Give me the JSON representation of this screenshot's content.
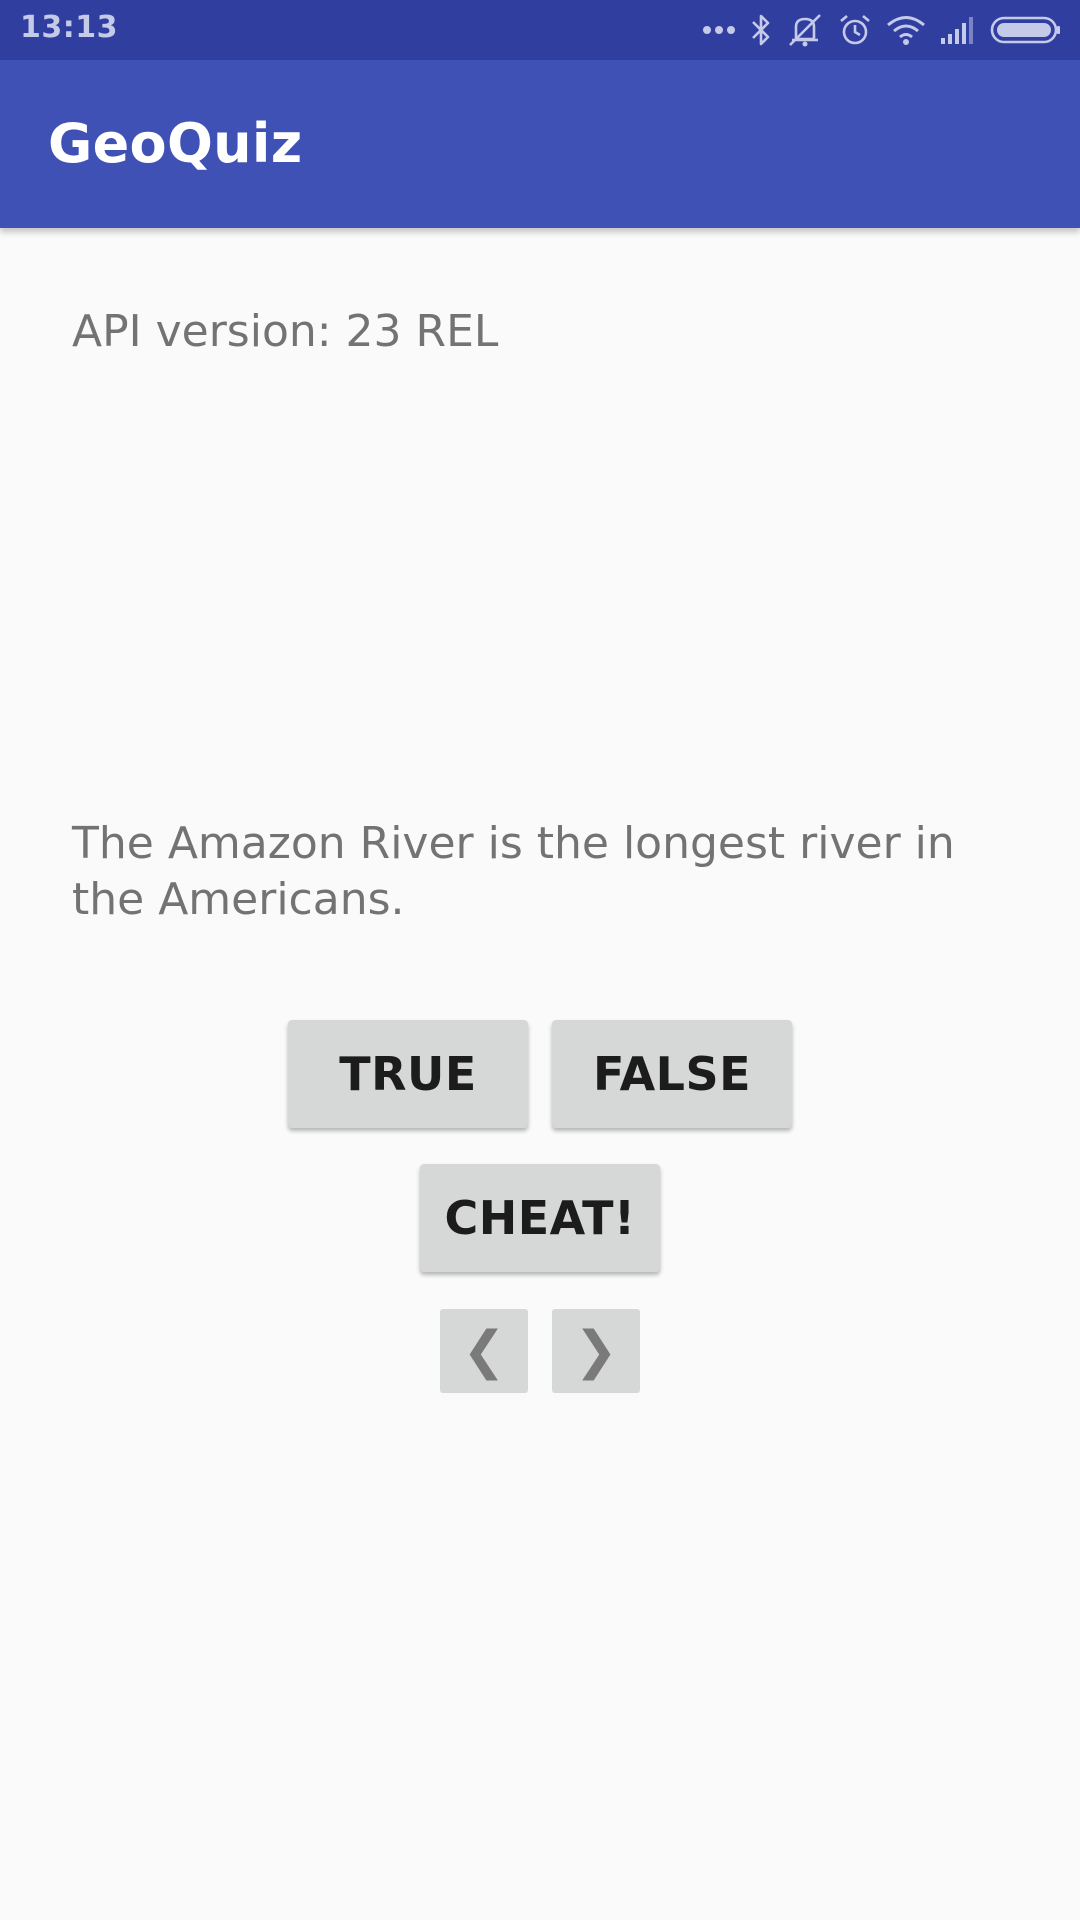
{
  "status_bar": {
    "time": "13:13",
    "icons": [
      "more-dots-icon",
      "bluetooth-icon",
      "vibrate-off-icon",
      "alarm-icon",
      "wifi-icon",
      "signal-icon",
      "battery-icon"
    ]
  },
  "app_bar": {
    "title": "GeoQuiz"
  },
  "main": {
    "api_version": "API version: 23 REL",
    "question": "The Amazon River is the longest river in the Americans.",
    "buttons": {
      "true_label": "TRUE",
      "false_label": "FALSE",
      "cheat_label": "CHEAT!",
      "prev_glyph": "❮",
      "next_glyph": "❯"
    }
  },
  "colors": {
    "status_bar": "#303f9f",
    "app_bar": "#3f51b5",
    "background": "#fafafa",
    "button": "#d6d7d7",
    "secondary_text": "#737373"
  }
}
